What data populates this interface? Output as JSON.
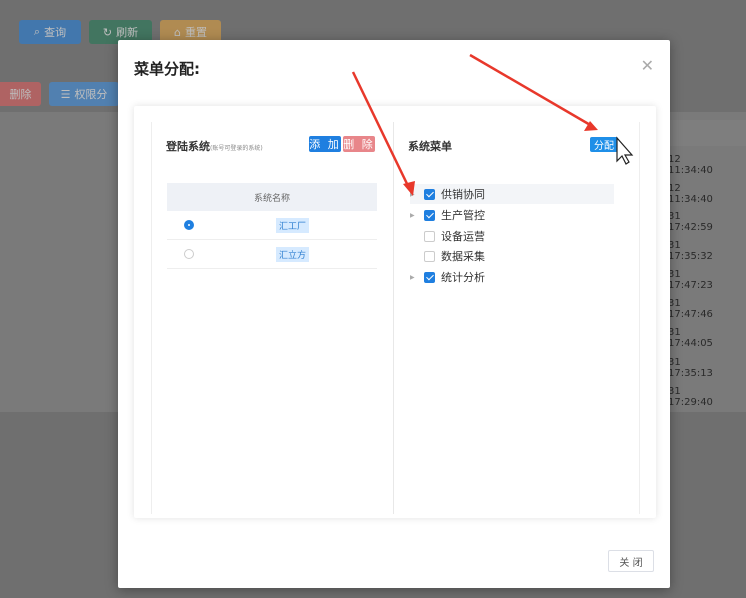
{
  "background": {
    "toolbar": {
      "query_label": "查询",
      "refresh_label": "刷新",
      "reset_label": "重置"
    },
    "actions": {
      "delete_label": "删除",
      "perm_label": "权限分"
    },
    "times": [
      "12 11:34:40",
      "12 11:34:40",
      "31 17:42:59",
      "31 17:35:32",
      "31 17:47:23",
      "31 17:47:46",
      "31 17:44:05",
      "31 17:35:13",
      "31 17:29:40"
    ]
  },
  "modal": {
    "title": "菜单分配:",
    "close_label": "关 闭",
    "left": {
      "title": "登陆系统",
      "hint": "(账号可登录的系统)",
      "add_label": "添 加",
      "delete_label": "删 除",
      "table_header": "系统名称",
      "rows": [
        {
          "name": "汇工厂",
          "selected": true
        },
        {
          "name": "汇立方",
          "selected": false
        }
      ]
    },
    "right": {
      "title": "系统菜单",
      "assign_label": "分配",
      "tree": [
        {
          "label": "供销协同",
          "checked": true,
          "has_children": true
        },
        {
          "label": "生产管控",
          "checked": true,
          "has_children": true
        },
        {
          "label": "设备运营",
          "checked": false,
          "has_children": false
        },
        {
          "label": "数据采集",
          "checked": false,
          "has_children": false
        },
        {
          "label": "统计分析",
          "checked": true,
          "has_children": true
        }
      ]
    }
  },
  "colors": {
    "primary": "#1f7fe0",
    "danger": "#e8868a",
    "arrow": "#e8382b"
  }
}
